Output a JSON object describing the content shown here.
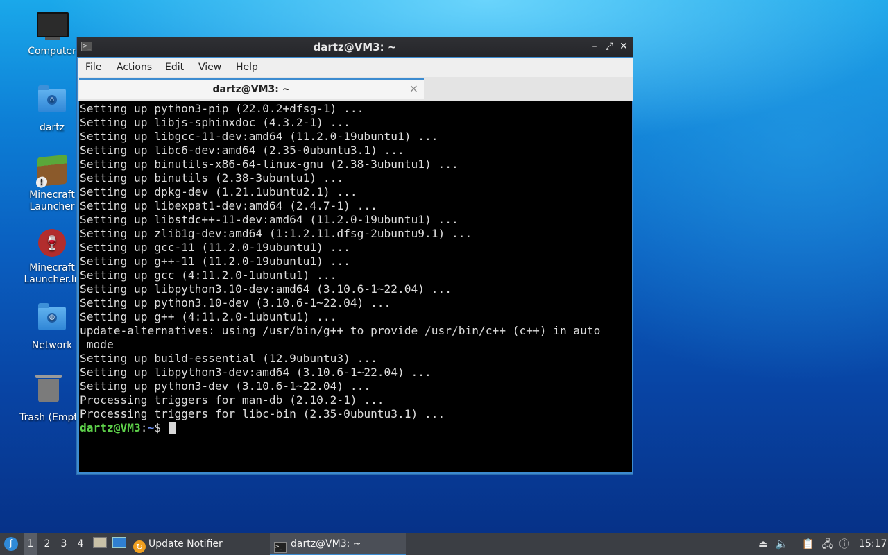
{
  "desktop": {
    "icons": [
      {
        "label": "Computer"
      },
      {
        "label": "dartz"
      },
      {
        "label_line1": "Minecraft",
        "label_line2": "Launcher"
      },
      {
        "label_line1": "Minecraft",
        "label_line2": "Launcher.ln"
      },
      {
        "label": "Network"
      },
      {
        "label": "Trash (Empt"
      }
    ]
  },
  "window": {
    "title": "dartz@VM3: ~",
    "controls": {
      "minimize": "–",
      "maximize": "⤢",
      "close": "✕"
    },
    "menu": [
      "File",
      "Actions",
      "Edit",
      "View",
      "Help"
    ],
    "tab": {
      "label": "dartz@VM3: ~",
      "close": "×"
    }
  },
  "terminal": {
    "lines": [
      "Setting up python3-pip (22.0.2+dfsg-1) ...",
      "Setting up libjs-sphinxdoc (4.3.2-1) ...",
      "Setting up libgcc-11-dev:amd64 (11.2.0-19ubuntu1) ...",
      "Setting up libc6-dev:amd64 (2.35-0ubuntu3.1) ...",
      "Setting up binutils-x86-64-linux-gnu (2.38-3ubuntu1) ...",
      "Setting up binutils (2.38-3ubuntu1) ...",
      "Setting up dpkg-dev (1.21.1ubuntu2.1) ...",
      "Setting up libexpat1-dev:amd64 (2.4.7-1) ...",
      "Setting up libstdc++-11-dev:amd64 (11.2.0-19ubuntu1) ...",
      "Setting up zlib1g-dev:amd64 (1:1.2.11.dfsg-2ubuntu9.1) ...",
      "Setting up gcc-11 (11.2.0-19ubuntu1) ...",
      "Setting up g++-11 (11.2.0-19ubuntu1) ...",
      "Setting up gcc (4:11.2.0-1ubuntu1) ...",
      "Setting up libpython3.10-dev:amd64 (3.10.6-1~22.04) ...",
      "Setting up python3.10-dev (3.10.6-1~22.04) ...",
      "Setting up g++ (4:11.2.0-1ubuntu1) ...",
      "update-alternatives: using /usr/bin/g++ to provide /usr/bin/c++ (c++) in auto",
      " mode",
      "Setting up build-essential (12.9ubuntu3) ...",
      "Setting up libpython3-dev:amd64 (3.10.6-1~22.04) ...",
      "Setting up python3-dev (3.10.6-1~22.04) ...",
      "Processing triggers for man-db (2.10.2-1) ...",
      "Processing triggers for libc-bin (2.35-0ubuntu3.1) ..."
    ],
    "prompt_user": "dartz@VM3",
    "prompt_colon": ":",
    "prompt_path": "~",
    "prompt_symbol": "$ "
  },
  "taskbar": {
    "workspaces": [
      "1",
      "2",
      "3",
      "4"
    ],
    "active_workspace": "1",
    "tasks": [
      {
        "label": "Update Notifier",
        "icon": "update-notifier-icon"
      },
      {
        "label": "dartz@VM3: ~",
        "icon": "terminal-icon"
      }
    ],
    "clock": "15:17"
  }
}
